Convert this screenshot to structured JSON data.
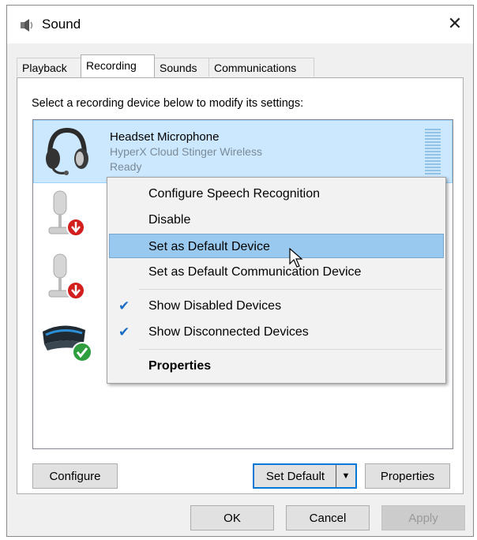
{
  "window": {
    "title": "Sound",
    "close_symbol": "✕"
  },
  "tabs": [
    {
      "label": "Playback",
      "active": false
    },
    {
      "label": "Recording",
      "active": true
    },
    {
      "label": "Sounds",
      "active": false
    },
    {
      "label": "Communications",
      "active": false
    }
  ],
  "instruction": "Select a recording device below to modify its settings:",
  "devices": [
    {
      "name": "Headset Microphone",
      "subtitle": "HyperX Cloud Stinger Wireless",
      "status": "Ready",
      "icon": "headset-icon",
      "selected": true
    },
    {
      "icon": "microphone-disabled-icon",
      "badge": "down-arrow-badge"
    },
    {
      "icon": "microphone-disabled-icon",
      "badge": "down-arrow-badge"
    },
    {
      "icon": "webcam-default-icon",
      "badge": "green-check-badge"
    }
  ],
  "context_menu": {
    "items": [
      {
        "label": "Configure Speech Recognition"
      },
      {
        "label": "Disable"
      },
      {
        "label": "Set as Default Device",
        "highlighted": true
      },
      {
        "label": "Set as Default Communication Device"
      },
      {
        "label": "Show Disabled Devices",
        "checked": true
      },
      {
        "label": "Show Disconnected Devices",
        "checked": true
      },
      {
        "label": "Properties",
        "bold": true
      }
    ],
    "check_symbol": "✔"
  },
  "buttons": {
    "configure": "Configure",
    "set_default": "Set Default",
    "set_default_arrow": "▼",
    "properties": "Properties",
    "ok": "OK",
    "cancel": "Cancel",
    "apply": "Apply"
  },
  "colors": {
    "selection_bg": "#cce8ff",
    "menu_highlight": "#99c9ef",
    "check": "#1a6fc4",
    "default_badge": "#2e9e3e",
    "disabled_badge": "#d11f1f"
  }
}
